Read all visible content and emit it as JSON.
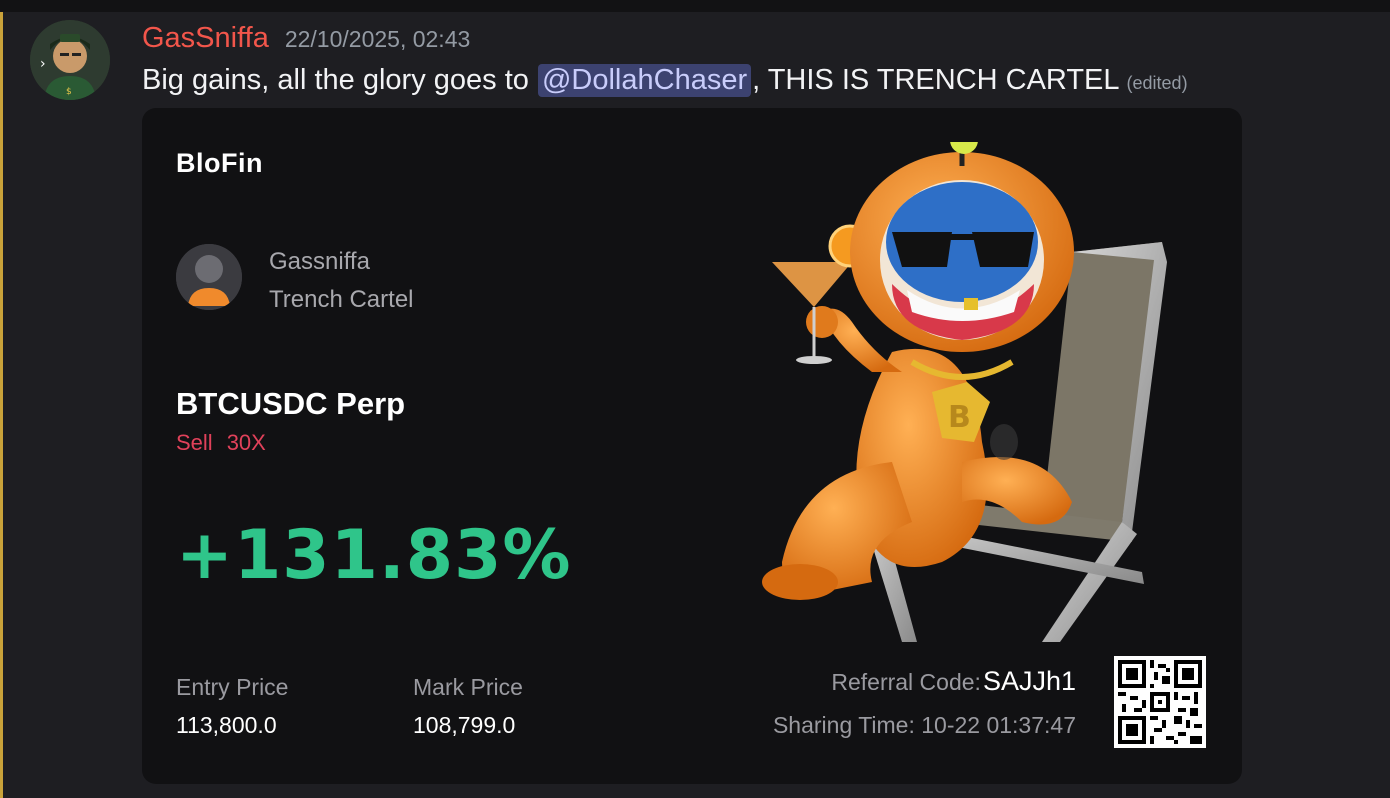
{
  "message": {
    "username": "GasSniffa",
    "timestamp": "22/10/2025, 02:43",
    "text_before": "Big gains, all the glory goes to ",
    "mention": "@DollahChaser",
    "text_after": ", THIS IS TRENCH CARTEL",
    "edited": "(edited)"
  },
  "card": {
    "brand": "BloFin",
    "profile_name": "Gassniffa",
    "profile_sub": "Trench Cartel",
    "pair": "BTCUSDC Perp",
    "side": "Sell",
    "leverage": "30X",
    "pnl": "+131.83%",
    "entry_label": "Entry Price",
    "entry_value": "113,800.0",
    "mark_label": "Mark Price",
    "mark_value": "108,799.0",
    "referral_label": "Referral Code:",
    "referral_code": "SAJJh1",
    "sharing_time": "Sharing Time: 10-22 01:37:47"
  },
  "colors": {
    "username": "#f2564b",
    "pnl": "#2fc58a",
    "sell": "#e0415a",
    "mention_bg": "#3c4270",
    "accent_bar": "#c9a23a"
  },
  "icons": {
    "avatar": "user-avatar-icon",
    "profile": "profile-placeholder-icon",
    "mascot": "mascot-illustration",
    "qr": "qr-code-icon"
  }
}
